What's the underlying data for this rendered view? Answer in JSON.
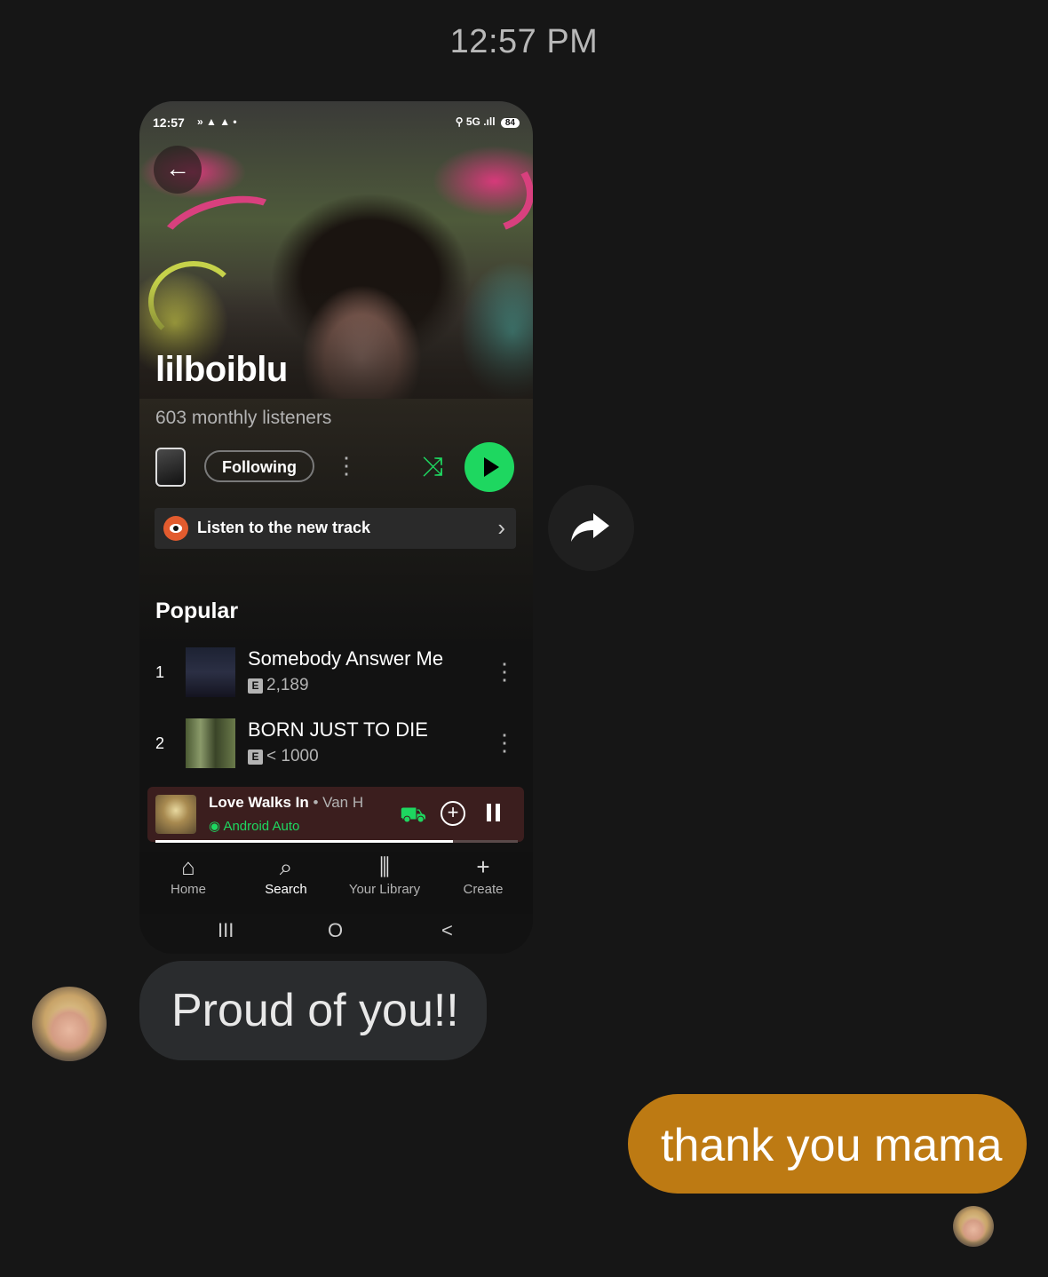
{
  "thread": {
    "timestamp": "12:57 PM"
  },
  "shared_screenshot": {
    "status_bar": {
      "time": "12:57",
      "network": "5G",
      "battery": "84"
    },
    "artist": {
      "name": "lilboiblu",
      "monthly_listeners": "603 monthly listeners",
      "follow_label": "Following"
    },
    "promo": {
      "label": "Listen to the new track"
    },
    "popular": {
      "title": "Popular",
      "tracks": [
        {
          "rank": "1",
          "title": "Somebody Answer Me",
          "badge": "E",
          "plays": "2,189"
        },
        {
          "rank": "2",
          "title": "BORN JUST TO DIE",
          "badge": "E",
          "plays": "< 1000"
        }
      ]
    },
    "now_playing": {
      "title": "Love Walks In",
      "separator": " • ",
      "artist": "Van H",
      "device": "Android Auto",
      "progress": 0.82
    },
    "bottom_nav": [
      {
        "label": "Home",
        "icon": "home-icon"
      },
      {
        "label": "Search",
        "icon": "search-icon"
      },
      {
        "label": "Your Library",
        "icon": "library-icon"
      },
      {
        "label": "Create",
        "icon": "plus-icon"
      }
    ],
    "system_nav": {
      "recents": "III",
      "home": "O",
      "back": "<"
    }
  },
  "messages": [
    {
      "direction": "incoming",
      "text": "Proud of you!!"
    },
    {
      "direction": "outgoing",
      "text": "thank you mama"
    }
  ],
  "colors": {
    "background": "#161616",
    "incoming_bubble": "#2a2c2e",
    "outgoing_bubble": "#bd7a13",
    "spotify_green": "#1ed760"
  }
}
